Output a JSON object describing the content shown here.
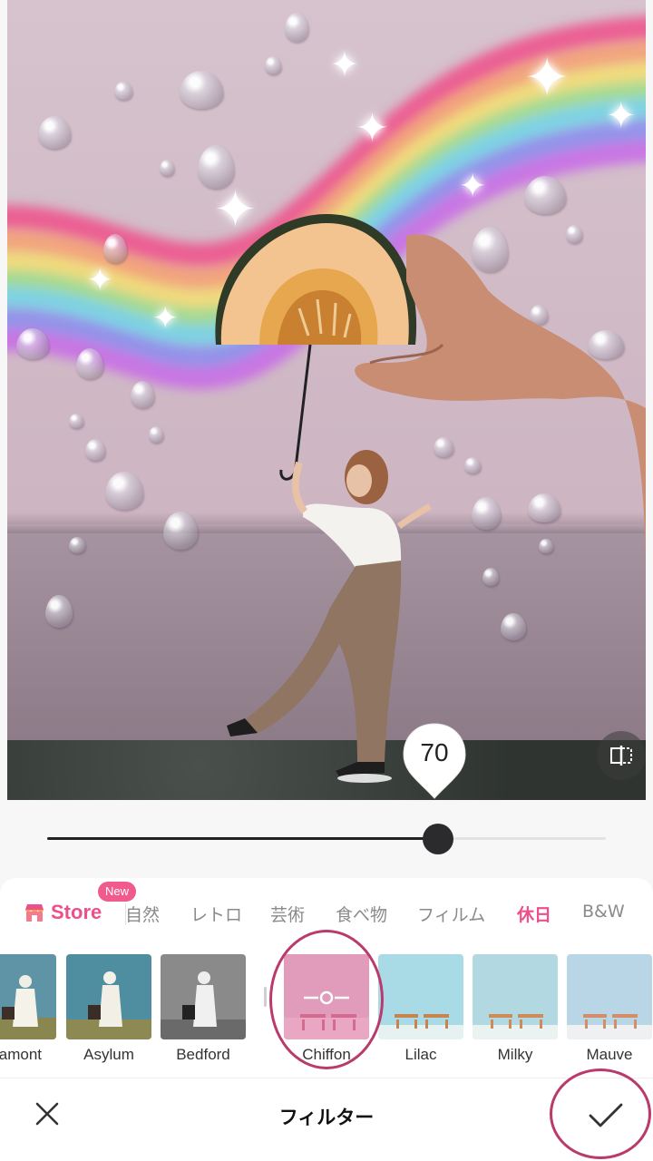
{
  "slider": {
    "value": "70",
    "fraction": 0.7
  },
  "store": {
    "label": "Store",
    "badge": "New"
  },
  "tabs": [
    {
      "label": "自然",
      "active": false
    },
    {
      "label": "レトロ",
      "active": false
    },
    {
      "label": "芸術",
      "active": false
    },
    {
      "label": "食べ物",
      "active": false
    },
    {
      "label": "フィルム",
      "active": false
    },
    {
      "label": "休日",
      "active": true
    },
    {
      "label": "B&W",
      "active": false
    }
  ],
  "filters": [
    {
      "label": "amont",
      "style": "woman"
    },
    {
      "label": "Asylum",
      "style": "woman"
    },
    {
      "label": "Bedford",
      "style": "woman-bw"
    },
    {
      "label": "Chiffon",
      "style": "pink-selected"
    },
    {
      "label": "Lilac",
      "style": "beach"
    },
    {
      "label": "Milky",
      "style": "beach"
    },
    {
      "label": "Mauve",
      "style": "beach"
    }
  ],
  "footer": {
    "title": "フィルター"
  },
  "colors": {
    "accent": "#ee4e8a",
    "annotation": "#b93a6b"
  },
  "icons": {
    "close": "close-icon",
    "confirm": "checkmark-icon",
    "compare": "compare-icon",
    "store": "store-icon"
  }
}
